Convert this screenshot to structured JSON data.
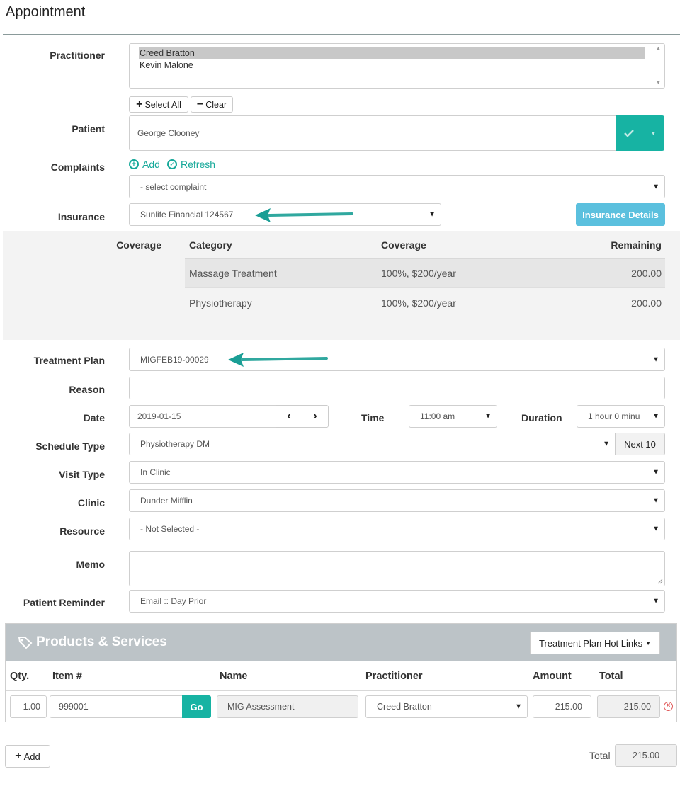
{
  "page": {
    "title": "Appointment"
  },
  "practitioner": {
    "label": "Practitioner",
    "options": [
      "Creed Bratton",
      "Kevin Malone"
    ],
    "selected_index": 0,
    "select_all_label": "Select All",
    "clear_label": "Clear"
  },
  "patient": {
    "label": "Patient",
    "value": "George Clooney"
  },
  "complaints": {
    "label": "Complaints",
    "add_label": "Add",
    "refresh_label": "Refresh",
    "placeholder": "- select complaint"
  },
  "insurance": {
    "label": "Insurance",
    "value": "Sunlife Financial 124567",
    "details_button": "Insurance Details"
  },
  "coverage": {
    "label": "Coverage",
    "headers": [
      "Category",
      "Coverage",
      "Remaining"
    ],
    "rows": [
      {
        "category": "Massage Treatment",
        "coverage": "100%, $200/year",
        "remaining": "200.00"
      },
      {
        "category": "Physiotherapy",
        "coverage": "100%, $200/year",
        "remaining": "200.00"
      }
    ]
  },
  "treatment_plan": {
    "label": "Treatment Plan",
    "value": "MIGFEB19-00029"
  },
  "reason": {
    "label": "Reason",
    "value": ""
  },
  "date": {
    "label": "Date",
    "value": "2019-01-15"
  },
  "time": {
    "label": "Time",
    "value": "11:00 am"
  },
  "duration": {
    "label": "Duration",
    "value": "1 hour 0 minu"
  },
  "schedule_type": {
    "label": "Schedule Type",
    "value": "Physiotherapy DM",
    "next_button": "Next 10"
  },
  "visit_type": {
    "label": "Visit Type",
    "value": "In Clinic"
  },
  "clinic": {
    "label": "Clinic",
    "value": "Dunder Mifflin"
  },
  "resource": {
    "label": "Resource",
    "value": "- Not Selected -"
  },
  "memo": {
    "label": "Memo",
    "value": ""
  },
  "patient_reminder": {
    "label": "Patient Reminder",
    "value": "Email :: Day Prior"
  },
  "products_services": {
    "title": "Products & Services",
    "hot_links_label": "Treatment Plan Hot Links",
    "columns": [
      "Qty.",
      "Item #",
      "Name",
      "Practitioner",
      "Amount",
      "Total"
    ],
    "rows": [
      {
        "qty": "1.00",
        "item": "999001",
        "go": "Go",
        "name": "MIG Assessment",
        "practitioner": "Creed Bratton",
        "amount": "215.00",
        "total": "215.00"
      }
    ]
  },
  "footer": {
    "add_label": "Add",
    "total_label": "Total",
    "total_value": "215.00"
  },
  "colors": {
    "accent": "#17b3a3",
    "info": "#5bc0de",
    "danger": "#e05a5a",
    "header_gray": "#bcc3c7"
  }
}
